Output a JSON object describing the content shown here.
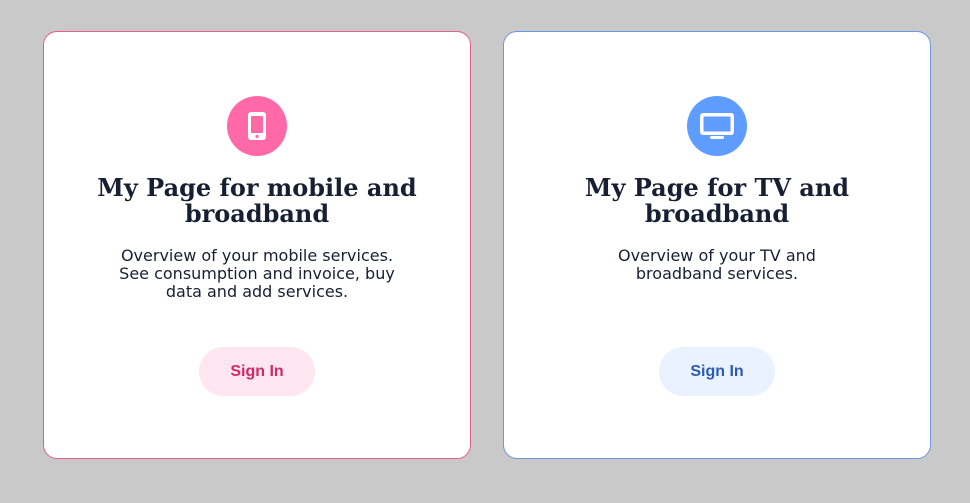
{
  "cards": [
    {
      "title": "My Page for mobile and broadband",
      "description": "Overview of your mobile services. See consumption and invoice, buy data and add services.",
      "button_label": "Sign In",
      "icon": "mobile-phone-icon",
      "accent_color": "#ff69a8",
      "border_color": "#e0608f",
      "button_bg": "#ffe6f0",
      "button_text_color": "#ce2a69"
    },
    {
      "title": "My Page for TV and broadband",
      "description": "Overview of your TV and broadband services.",
      "button_label": "Sign In",
      "icon": "tv-monitor-icon",
      "accent_color": "#5f9cff",
      "border_color": "#6f96df",
      "button_bg": "#eaf1ff",
      "button_text_color": "#2c5bb2"
    }
  ]
}
